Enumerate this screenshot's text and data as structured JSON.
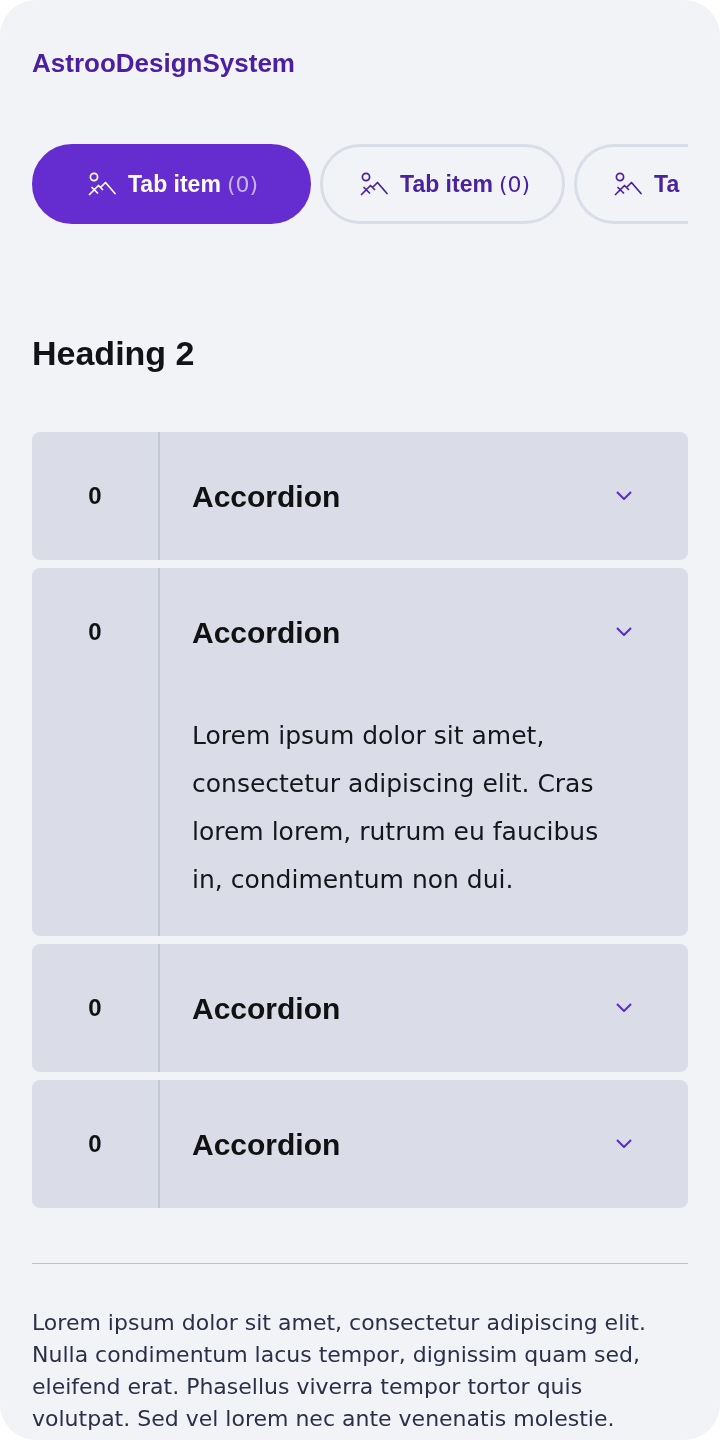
{
  "brand": {
    "title": "AstrooDesignSystem"
  },
  "tabs": [
    {
      "label": "Tab item",
      "count": "(0)",
      "selected": true
    },
    {
      "label": "Tab item",
      "count": "(0)",
      "selected": false
    },
    {
      "label": "Ta",
      "selected": false
    }
  ],
  "heading": "Heading 2",
  "accordion": [
    {
      "number": "0",
      "title": "Accordion",
      "expanded": false
    },
    {
      "number": "0",
      "title": "Accordion",
      "expanded": true,
      "body": "Lorem ipsum dolor sit amet, consectetur adipiscing elit. Cras lorem lorem, rutrum eu faucibus in, condimentum non dui."
    },
    {
      "number": "0",
      "title": "Accordion",
      "expanded": false
    },
    {
      "number": "0",
      "title": "Accordion",
      "expanded": false
    }
  ],
  "paragraph": "Lorem ipsum dolor sit amet, consectetur adipiscing elit. Nulla condimentum lacus tempor, dignissim quam sed, eleifend erat. Phasellus viverra tempor tortor quis volutpat. Sed vel lorem nec ante venenatis molestie."
}
